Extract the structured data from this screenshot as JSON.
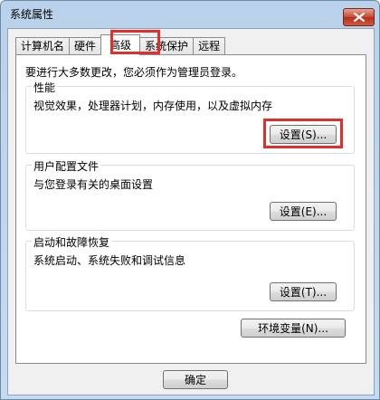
{
  "window": {
    "title": "系统属性"
  },
  "tabs": [
    {
      "label": "计算机名"
    },
    {
      "label": "硬件"
    },
    {
      "label": "高级"
    },
    {
      "label": "系统保护"
    },
    {
      "label": "远程"
    }
  ],
  "active_tab": "高级",
  "intro": "要进行大多数更改，您必须作为管理员登录。",
  "groups": {
    "performance": {
      "title": "性能",
      "desc": "视觉效果，处理器计划，内存使用，以及虚拟内存",
      "button": "设置(S)..."
    },
    "user_profiles": {
      "title": "用户配置文件",
      "desc": "与您登录有关的桌面设置",
      "button": "设置(E)..."
    },
    "startup_recovery": {
      "title": "启动和故障恢复",
      "desc": "系统启动、系统失败和调试信息",
      "button": "设置(T)..."
    }
  },
  "env_button": "环境变量(N)...",
  "ok_button": "确定",
  "colors": {
    "highlight": "#e0302e",
    "titlebar": "#b9d1ea"
  }
}
